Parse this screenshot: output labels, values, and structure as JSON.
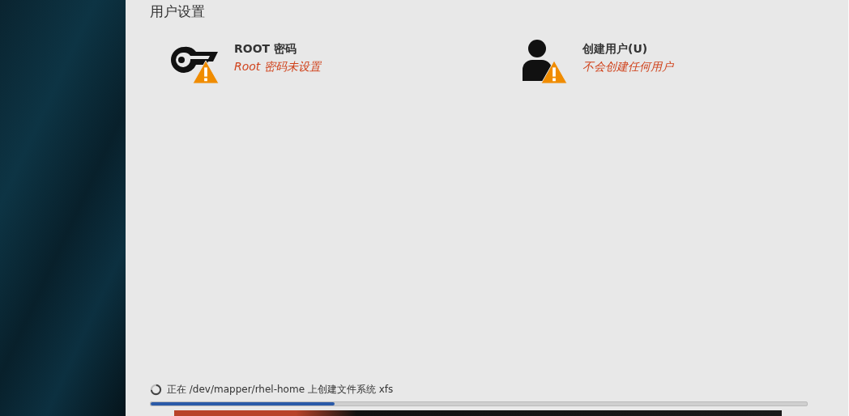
{
  "section": {
    "title": "用户设置"
  },
  "spokes": [
    {
      "kind": "key",
      "title": "ROOT 密码",
      "status": "Root 密码未设置",
      "warning": true
    },
    {
      "kind": "user",
      "title": "创建用户(U)",
      "status": "不会创建任何用户",
      "warning": true
    }
  ],
  "progress": {
    "message": "正在 /dev/mapper/rhel-home 上创建文件系统 xfs",
    "level": 0.28
  }
}
